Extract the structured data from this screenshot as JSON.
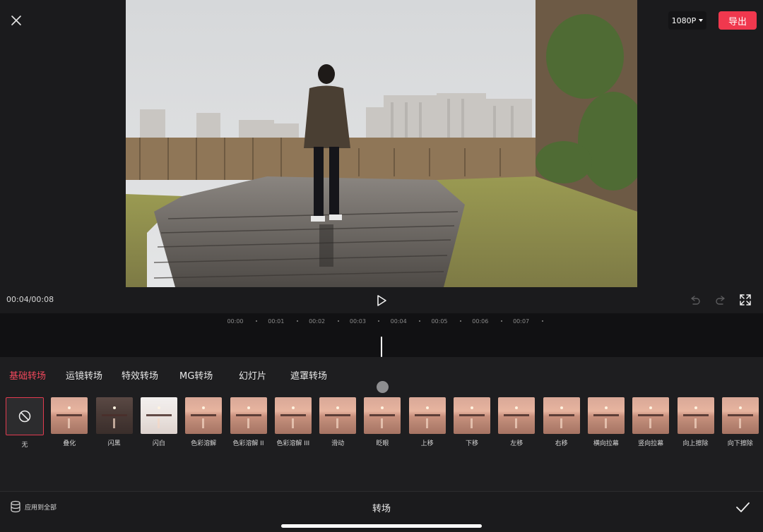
{
  "header": {
    "resolution_label": "1080P",
    "export_label": "导出"
  },
  "player": {
    "time_readout": "00:04/00:08"
  },
  "timeline": {
    "ticks": [
      "00:00",
      "00:01",
      "00:02",
      "00:03",
      "00:04",
      "00:05",
      "00:06",
      "00:07"
    ]
  },
  "categories": [
    {
      "label": "基础转场",
      "active": true
    },
    {
      "label": "运镜转场",
      "active": false
    },
    {
      "label": "特效转场",
      "active": false
    },
    {
      "label": "MG转场",
      "active": false
    },
    {
      "label": "幻灯片",
      "active": false
    },
    {
      "label": "遮罩转场",
      "active": false
    }
  ],
  "transitions": [
    {
      "label": "无",
      "thumb": "none"
    },
    {
      "label": "叠化",
      "thumb": "sunset"
    },
    {
      "label": "闪黑",
      "thumb": "dark"
    },
    {
      "label": "闪白",
      "thumb": "light"
    },
    {
      "label": "色彩溶解",
      "thumb": "sunset"
    },
    {
      "label": "色彩溶解 II",
      "thumb": "sunset"
    },
    {
      "label": "色彩溶解 III",
      "thumb": "sunset"
    },
    {
      "label": "滑动",
      "thumb": "sunset"
    },
    {
      "label": "眨眼",
      "thumb": "sunset"
    },
    {
      "label": "上移",
      "thumb": "sunset"
    },
    {
      "label": "下移",
      "thumb": "sunset"
    },
    {
      "label": "左移",
      "thumb": "sunset"
    },
    {
      "label": "右移",
      "thumb": "sunset"
    },
    {
      "label": "横向拉幕",
      "thumb": "sunset"
    },
    {
      "label": "竖向拉幕",
      "thumb": "sunset"
    },
    {
      "label": "向上擦除",
      "thumb": "sunset"
    },
    {
      "label": "向下擦除",
      "thumb": "sunset"
    }
  ],
  "footer": {
    "apply_all_label": "应用到全部",
    "title": "转场"
  },
  "colors": {
    "accent": "#f0384e",
    "background": "#1b1b1d"
  }
}
